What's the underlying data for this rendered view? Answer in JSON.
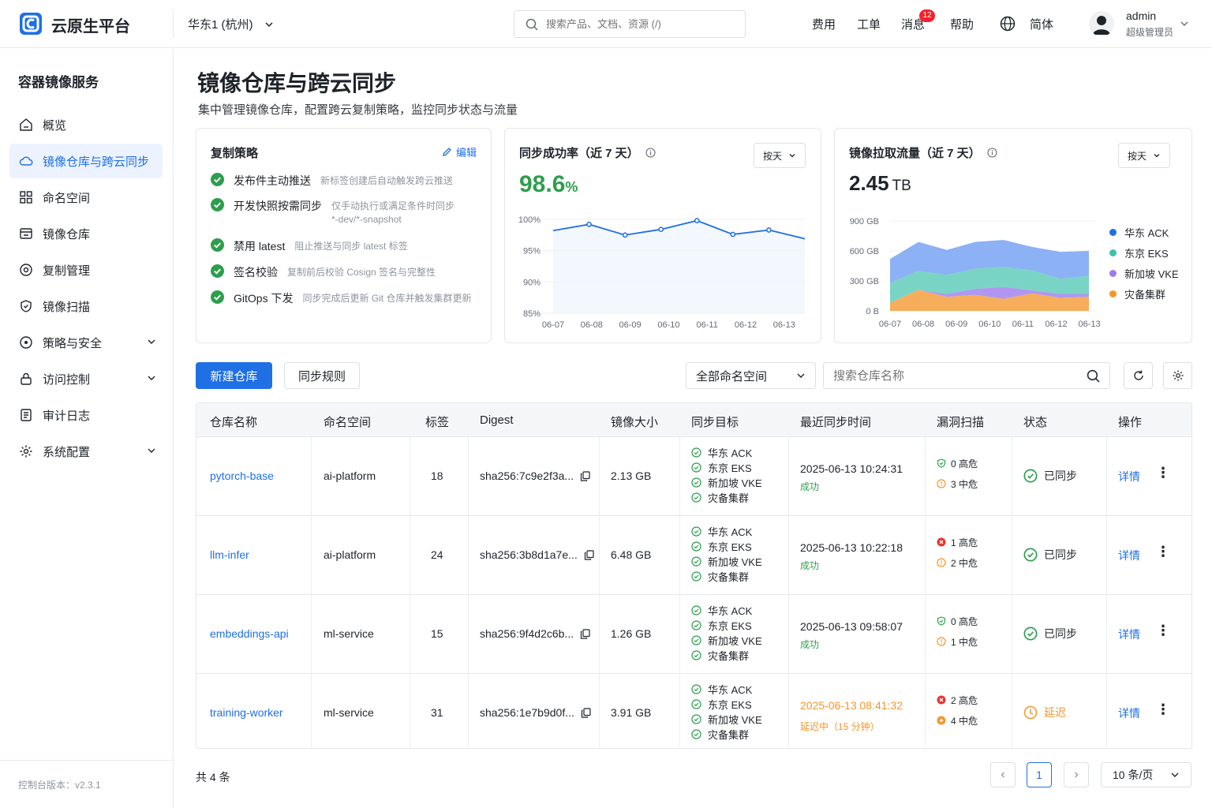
{
  "header": {
    "brand": "云原生平台",
    "region": "华东1 (杭州)",
    "search_placeholder": "搜索产品、文档、资源 (/)",
    "nav": [
      "费用",
      "工单",
      "消息",
      "帮助"
    ],
    "message_badge": "12",
    "language": "简体",
    "user_name": "admin",
    "user_role": "超级管理员"
  },
  "sidebar": {
    "title": "容器镜像服务",
    "items": [
      {
        "label": "概览"
      },
      {
        "label": "镜像仓库与跨云同步"
      },
      {
        "label": "命名空间"
      },
      {
        "label": "镜像仓库"
      },
      {
        "label": "复制管理"
      },
      {
        "label": "镜像扫描"
      },
      {
        "label": "策略与安全"
      },
      {
        "label": "访问控制"
      },
      {
        "label": "审计日志"
      },
      {
        "label": "系统配置"
      }
    ],
    "version": "控制台版本：v2.3.1"
  },
  "page": {
    "title": "镜像仓库与跨云同步",
    "subtitle": "集中管理镜像仓库，配置跨云复制策略，监控同步状态与流量"
  },
  "policy_card": {
    "title": "复制策略",
    "edit_label": "编辑",
    "rules": [
      {
        "name": "发布件主动推送",
        "desc": "新标签创建后自动触发跨云推送",
        "desc2": ""
      },
      {
        "name": "开发快照按需同步",
        "desc": "仅手动执行或满足条件时同步",
        "desc2": "*-dev/*-snapshot"
      },
      {
        "name": "禁用 latest",
        "desc": "阻止推送与同步 latest 标签",
        "desc2": ""
      },
      {
        "name": "签名校验",
        "desc": "复制前后校验 Cosign 签名与完整性",
        "desc2": ""
      },
      {
        "name": "GitOps 下发",
        "desc": "同步完成后更新 Git 仓库并触发集群更新",
        "desc2": ""
      }
    ]
  },
  "success_card": {
    "title": "同步成功率（近 7 天）",
    "granularity": "按天",
    "kpi_value": "98.6",
    "kpi_unit": "%",
    "accent": "#2e9e4d"
  },
  "traffic_card": {
    "title": "镜像拉取流量（近 7 天）",
    "granularity": "按天",
    "kpi_value": "2.45",
    "kpi_unit": "TB"
  },
  "chart_data": [
    {
      "type": "line",
      "title": "同步成功率（近 7 天）",
      "x": [
        "06-07",
        "06-08",
        "06-09",
        "06-10",
        "06-11",
        "06-12",
        "06-13"
      ],
      "series": [
        {
          "name": "",
          "values": [
            98.2,
            99.2,
            97.5,
            98.4,
            98.9,
            99.8,
            97.6,
            98.3,
            96.9
          ],
          "x_positions_note_free": true
        }
      ],
      "line_points": [
        98.2,
        99.2,
        97.5,
        98.4,
        99.8,
        97.6,
        98.3,
        96.9
      ],
      "yticks": [
        "100%",
        "95%",
        "90%",
        "85%"
      ],
      "ylim": [
        85,
        100
      ],
      "color": "#1f6fe5"
    },
    {
      "type": "area",
      "title": "镜像拉取流量（近 7 天）",
      "x": [
        "06-07",
        "06-08",
        "06-09",
        "06-10",
        "06-11",
        "06-12",
        "06-13"
      ],
      "stacked": true,
      "yticks": [
        "900 GB",
        "600 GB",
        "300 GB",
        "0 B"
      ],
      "ylim": [
        0,
        900
      ],
      "series": [
        {
          "name": "灾备集群",
          "color": "#f5a54a",
          "values": [
            80,
            210,
            140,
            160,
            120,
            175,
            130,
            140
          ]
        },
        {
          "name": "新加坡 VKE",
          "color": "#a98bf0",
          "values": [
            0,
            0,
            30,
            60,
            120,
            30,
            40,
            30
          ]
        },
        {
          "name": "东京 EKS",
          "color": "#6ccfbf",
          "values": [
            200,
            190,
            190,
            200,
            200,
            200,
            150,
            180
          ]
        },
        {
          "name": "华东 ACK",
          "color": "#7fa8f3",
          "values": [
            240,
            290,
            250,
            270,
            270,
            235,
            270,
            250
          ]
        }
      ],
      "legend": [
        {
          "name": "华东 ACK",
          "color": "#1f6fe5"
        },
        {
          "name": "东京 EKS",
          "color": "#3fc1ac"
        },
        {
          "name": "新加坡 VKE",
          "color": "#9b7cf0"
        },
        {
          "name": "灾备集群",
          "color": "#f5952a"
        }
      ],
      "legend_position": "right"
    }
  ],
  "toolbar": {
    "new_repo": "新建仓库",
    "sync_rules": "同步规则",
    "namespace_filter": "全部命名空间",
    "search_placeholder": "搜索仓库名称"
  },
  "table": {
    "headers": [
      "仓库名称",
      "命名空间",
      "标签",
      "Digest",
      "镜像大小",
      "同步目标",
      "最近同步时间",
      "漏洞扫描",
      "状态",
      "操作"
    ],
    "rows": [
      {
        "name": "pytorch-base",
        "namespace": "ai-platform",
        "tags": "18",
        "digest": "sha256:7c9e2f3a...",
        "size": "2.13 GB",
        "targets": [
          "华东 ACK",
          "东京 EKS",
          "新加坡 VKE",
          "灾备集群"
        ],
        "sync_time": "2025-06-13 10:24:31",
        "sync_result": "成功",
        "sync_state": "ok",
        "scan": [
          {
            "text": "0 高危",
            "level": "safe"
          },
          {
            "text": "3 中危",
            "level": "medium"
          }
        ],
        "status": "已同步",
        "status_state": "ok",
        "action": "详情"
      },
      {
        "name": "llm-infer",
        "namespace": "ai-platform",
        "tags": "24",
        "digest": "sha256:3b8d1a7e...",
        "size": "6.48 GB",
        "targets": [
          "华东 ACK",
          "东京 EKS",
          "新加坡 VKE",
          "灾备集群"
        ],
        "sync_time": "2025-06-13 10:22:18",
        "sync_result": "成功",
        "sync_state": "ok",
        "scan": [
          {
            "text": "1 高危",
            "level": "high"
          },
          {
            "text": "2 中危",
            "level": "medium"
          }
        ],
        "status": "已同步",
        "status_state": "ok",
        "action": "详情"
      },
      {
        "name": "embeddings-api",
        "namespace": "ml-service",
        "tags": "15",
        "digest": "sha256:9f4d2c6b...",
        "size": "1.26 GB",
        "targets": [
          "华东 ACK",
          "东京 EKS",
          "新加坡 VKE",
          "灾备集群"
        ],
        "sync_time": "2025-06-13 09:58:07",
        "sync_result": "成功",
        "sync_state": "ok",
        "scan": [
          {
            "text": "0 高危",
            "level": "safe"
          },
          {
            "text": "1 中危",
            "level": "medium"
          }
        ],
        "status": "已同步",
        "status_state": "ok",
        "action": "详情"
      },
      {
        "name": "training-worker",
        "namespace": "ml-service",
        "tags": "31",
        "digest": "sha256:1e7b9d0f...",
        "size": "3.91 GB",
        "targets": [
          "华东 ACK",
          "东京 EKS",
          "新加坡 VKE",
          "灾备集群"
        ],
        "sync_time": "2025-06-13 08:41:32",
        "sync_result": "延迟中（15 分钟）",
        "sync_state": "delay",
        "scan": [
          {
            "text": "2 高危",
            "level": "high"
          },
          {
            "text": "4 中危",
            "level": "medium-solid"
          }
        ],
        "status": "延迟",
        "status_state": "delay",
        "action": "详情"
      }
    ]
  },
  "pagination": {
    "total": "共 4 条",
    "current_page": "1",
    "page_size": "10 条/页"
  },
  "colors": {
    "primary": "#1f6fe5",
    "success": "#2e9e4d",
    "warning": "#f5952a",
    "danger": "#e5352f"
  }
}
